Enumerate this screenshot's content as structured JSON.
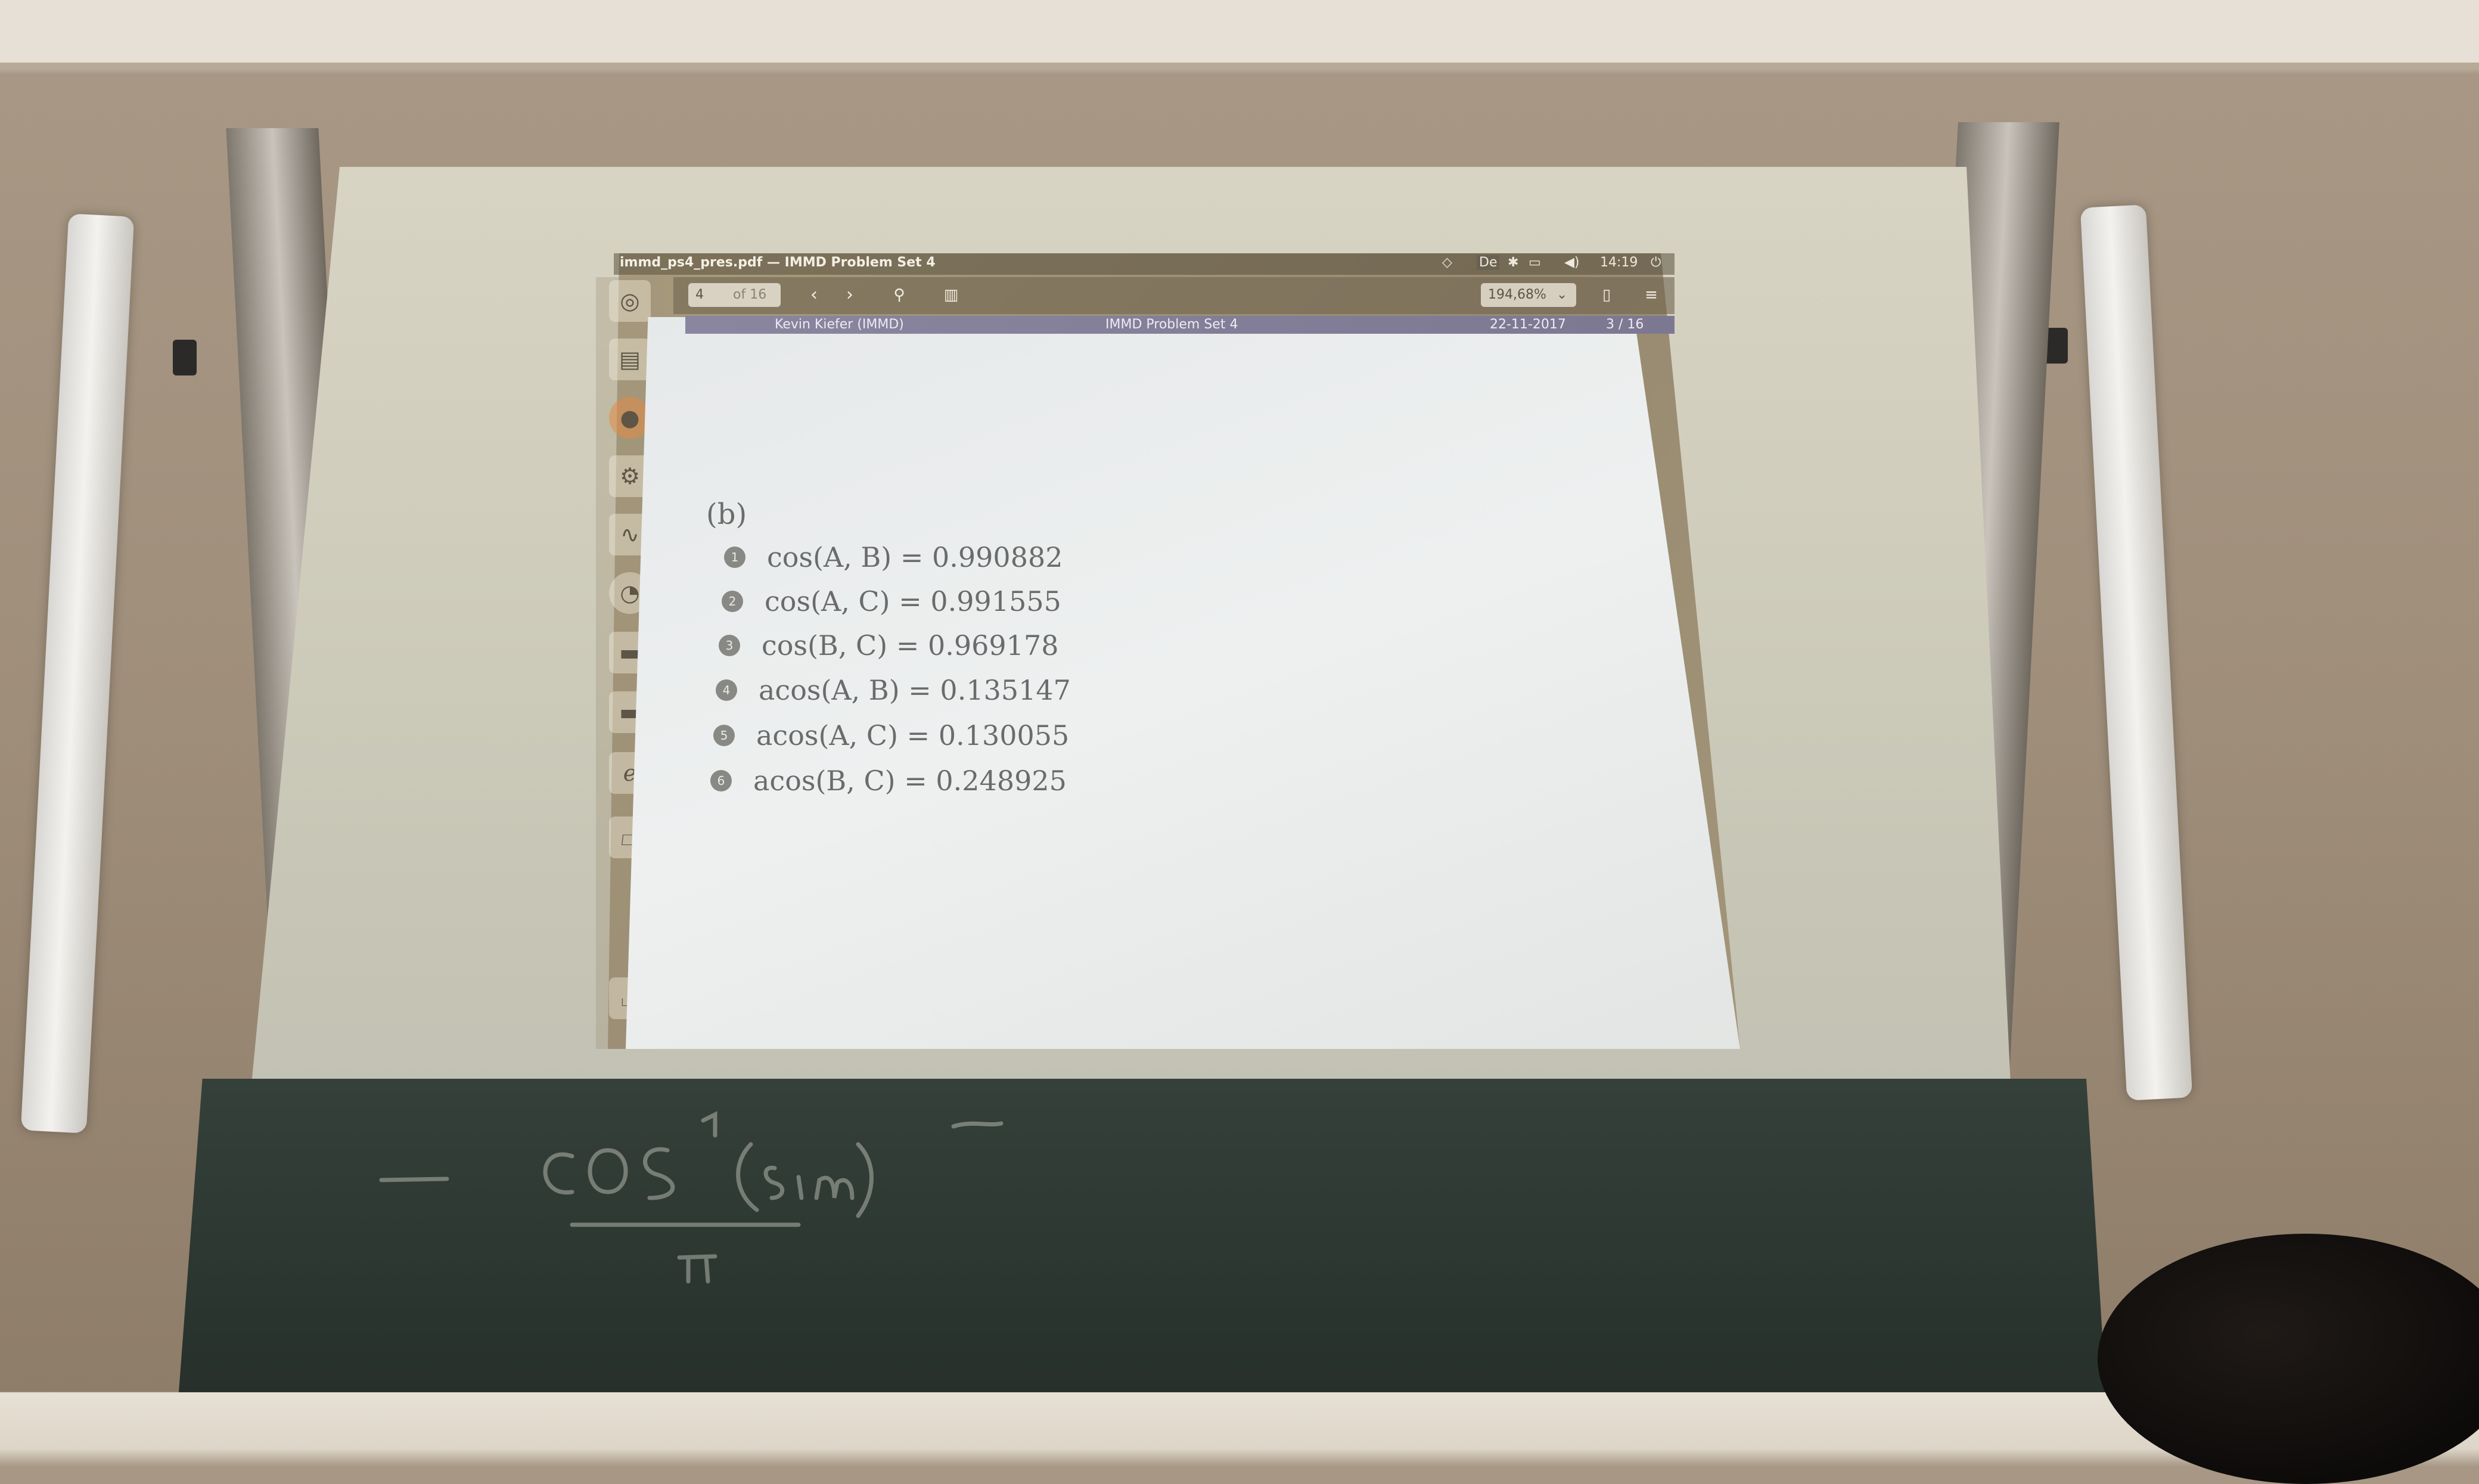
{
  "viewer": {
    "window_title": "immd_ps4_pres.pdf — IMMD Problem Set 4",
    "tray": {
      "keyboard": "De",
      "clock": "14:19"
    },
    "toolbar": {
      "current_page": "4",
      "page_of": "of 16",
      "zoom": "194,68%"
    }
  },
  "slide": {
    "header": {
      "author": "Kevin Kiefer (IMMD)",
      "title": "IMMD Problem Set 4",
      "date": "22-11-2017",
      "page": "3 / 16"
    },
    "section_label": "(b)",
    "items": [
      {
        "num": "1",
        "text": "cos(A, B) = 0.990882"
      },
      {
        "num": "2",
        "text": "cos(A, C) = 0.991555"
      },
      {
        "num": "3",
        "text": "cos(B, C) = 0.969178"
      },
      {
        "num": "4",
        "text": "acos(A, B) = 0.135147"
      },
      {
        "num": "5",
        "text": "acos(A, C) = 0.130055"
      },
      {
        "num": "6",
        "text": "acos(B, C) = 0.248925"
      }
    ]
  },
  "icons": [
    "ubuntu-icon",
    "files-icon",
    "firefox-icon",
    "settings-icon",
    "system-monitor-icon",
    "app-icon",
    "folder-icon",
    "folder-icon",
    "editor-icon",
    "drive-icon",
    "trash-icon"
  ],
  "colors": {
    "slide_header": "#8a86a0",
    "slide_background": "#e9ebeb",
    "chalkboard": "#2f3a34"
  }
}
